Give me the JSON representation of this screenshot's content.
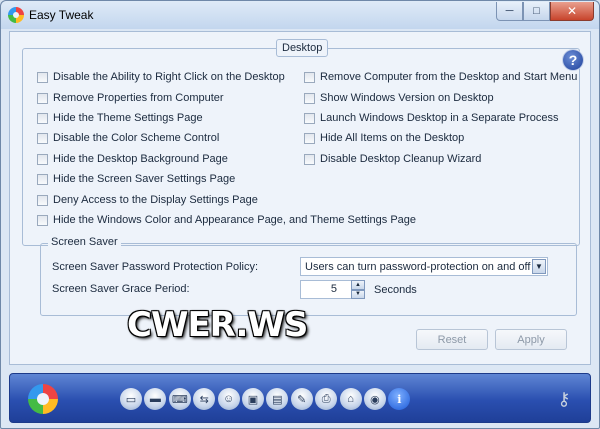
{
  "window": {
    "title": "Easy Tweak",
    "controls": {
      "minimize": "─",
      "maximize": "□",
      "close": "✕"
    }
  },
  "desktop_group": {
    "title": "Desktop",
    "help_icon": "?",
    "left_options": [
      "Disable the Ability to Right Click on the Desktop",
      "Remove Properties from Computer",
      "Hide the Theme Settings Page",
      "Disable the Color Scheme Control",
      "Hide the Desktop Background Page",
      "Hide the Screen Saver Settings Page",
      "Deny Access to the Display Settings Page",
      "Hide the Windows Color and Appearance Page, and Theme Settings Page"
    ],
    "right_options": [
      "Remove Computer from the Desktop and Start Menu",
      "Show Windows Version on Desktop",
      "Launch Windows Desktop in a Separate Process",
      "Hide All Items on the Desktop",
      "Disable Desktop Cleanup Wizard"
    ]
  },
  "screen_saver": {
    "title": "Screen Saver",
    "password_label": "Screen Saver Password Protection Policy:",
    "password_value": "Users can turn password-protection on and off",
    "grace_label": "Screen Saver Grace Period:",
    "grace_value": "5",
    "grace_unit": "Seconds"
  },
  "buttons": {
    "reset": "Reset",
    "apply": "Apply"
  },
  "watermark": "CWER.WS",
  "toolbar": {
    "icons": [
      "desktop-icon",
      "drive-icon",
      "keyboard-icon",
      "network-icon",
      "user-icon",
      "window-icon",
      "document-icon",
      "pen-icon",
      "printer-icon",
      "home-icon",
      "camera-icon",
      "info-icon"
    ],
    "icon_glyphs": [
      "▭",
      "▬",
      "⌨",
      "⇆",
      "☺",
      "▣",
      "▤",
      "✎",
      "⎙",
      "⌂",
      "◉",
      "i"
    ]
  }
}
